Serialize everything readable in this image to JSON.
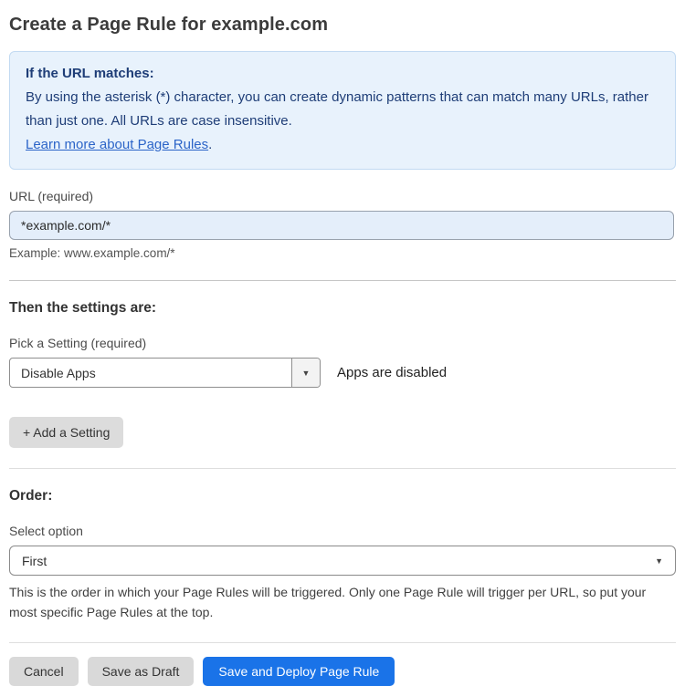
{
  "page": {
    "title": "Create a Page Rule for example.com"
  },
  "info_box": {
    "heading": "If the URL matches:",
    "body": "By using the asterisk (*) character, you can create dynamic patterns that can match many URLs, rather than just one. All URLs are case insensitive.",
    "link_label": "Learn more about Page Rules",
    "link_suffix": "."
  },
  "url_section": {
    "label": "URL (required)",
    "input_value": "*example.com/*",
    "hint": "Example: www.example.com/*"
  },
  "settings_section": {
    "heading": "Then the settings are:",
    "picker_label": "Pick a Setting (required)",
    "selected_setting": "Disable Apps",
    "setting_status": "Apps are disabled",
    "add_setting_label": "+ Add a Setting"
  },
  "order_section": {
    "heading": "Order:",
    "select_label": "Select option",
    "selected_option": "First",
    "hint": "This is the order in which your Page Rules will be triggered. Only one Page Rule will trigger per URL, so put your most specific Page Rules at the top."
  },
  "actions": {
    "cancel_label": "Cancel",
    "save_draft_label": "Save as Draft",
    "save_deploy_label": "Save and Deploy Page Rule"
  },
  "icons": {
    "dropdown_arrow": "▼"
  },
  "colors": {
    "info_background": "#e8f2fc",
    "info_border": "#c2daf2",
    "info_text": "#1e3d77",
    "link": "#2b64c8",
    "input_background": "#e4eefa",
    "primary_button": "#1a73e8",
    "secondary_button": "#d9d9d9"
  }
}
